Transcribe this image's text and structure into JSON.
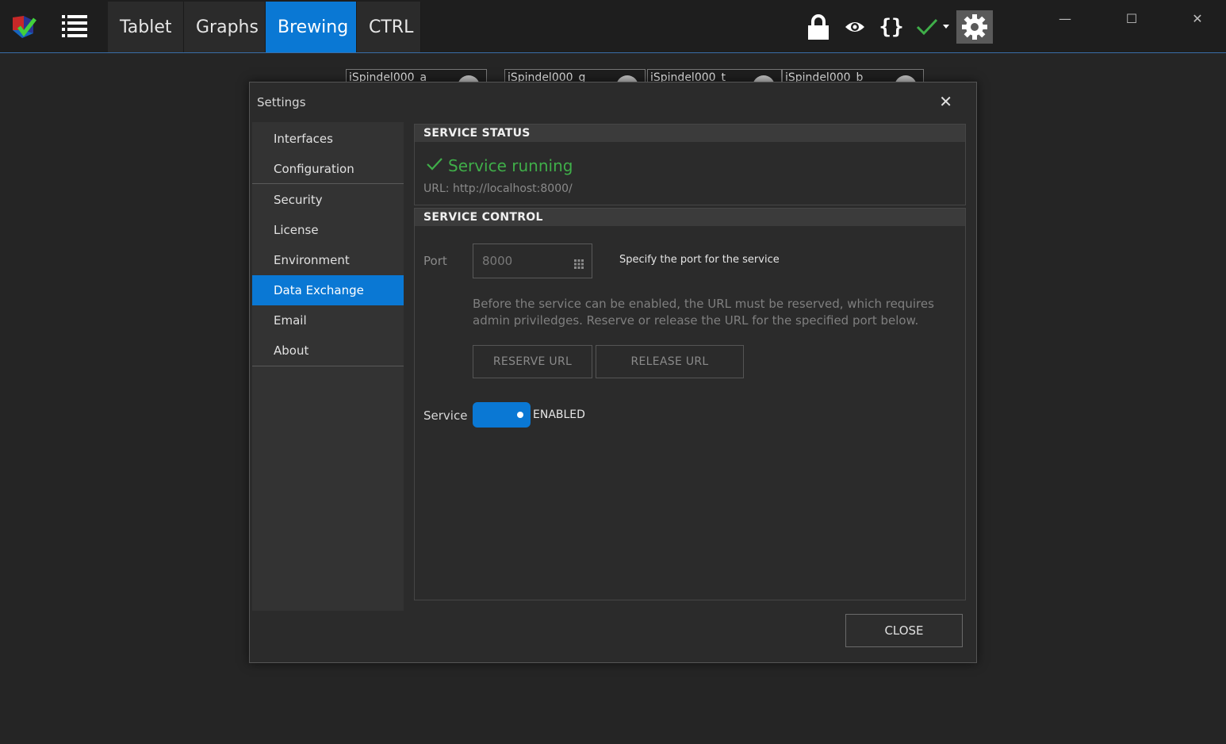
{
  "topbar": {
    "tabs": [
      {
        "label": "Tablet",
        "active": false
      },
      {
        "label": "Graphs",
        "active": false
      },
      {
        "label": "Brewing",
        "active": true
      },
      {
        "label": "CTRL",
        "active": false
      }
    ],
    "icons": [
      "app-logo-icon",
      "menu-list-icon",
      "lock-icon",
      "eye-icon",
      "braces-icon",
      "checkmark-icon",
      "dropdown-caret-icon",
      "gear-icon"
    ],
    "window_controls": {
      "minimize": "—",
      "maximize": "☐",
      "close": "✕"
    },
    "accent": "#0a78d4"
  },
  "background_cards": [
    {
      "label": "iSpindel000_a"
    },
    {
      "label": "iSpindel000_g"
    },
    {
      "label": "iSpindel000_t"
    },
    {
      "label": "iSpindel000_b"
    }
  ],
  "dialog": {
    "title": "Settings",
    "close_glyph": "✕",
    "nav": [
      {
        "label": "Interfaces",
        "active": false
      },
      {
        "label": "Configuration",
        "active": false
      },
      {
        "label": "Security",
        "active": false
      },
      {
        "label": "License",
        "active": false
      },
      {
        "label": "Environment",
        "active": false
      },
      {
        "label": "Data Exchange",
        "active": true
      },
      {
        "label": "Email",
        "active": false
      },
      {
        "label": "About",
        "active": false
      }
    ],
    "status": {
      "heading": "SERVICE STATUS",
      "state_text": "Service running",
      "state_color": "#3fae49",
      "url": "URL: http://localhost:8000/"
    },
    "control": {
      "heading": "SERVICE CONTROL",
      "port_label": "Port",
      "port_value": "8000",
      "port_hint": "Specify the port for the service",
      "description": "Before the service can be enabled, the URL must be reserved, which requires admin priviledges. Reserve or release the URL for the specified port below.",
      "reserve_label": "RESERVE URL",
      "release_label": "RELEASE URL",
      "service_label": "Service",
      "service_state": "ENABLED"
    },
    "close_label": "CLOSE"
  }
}
